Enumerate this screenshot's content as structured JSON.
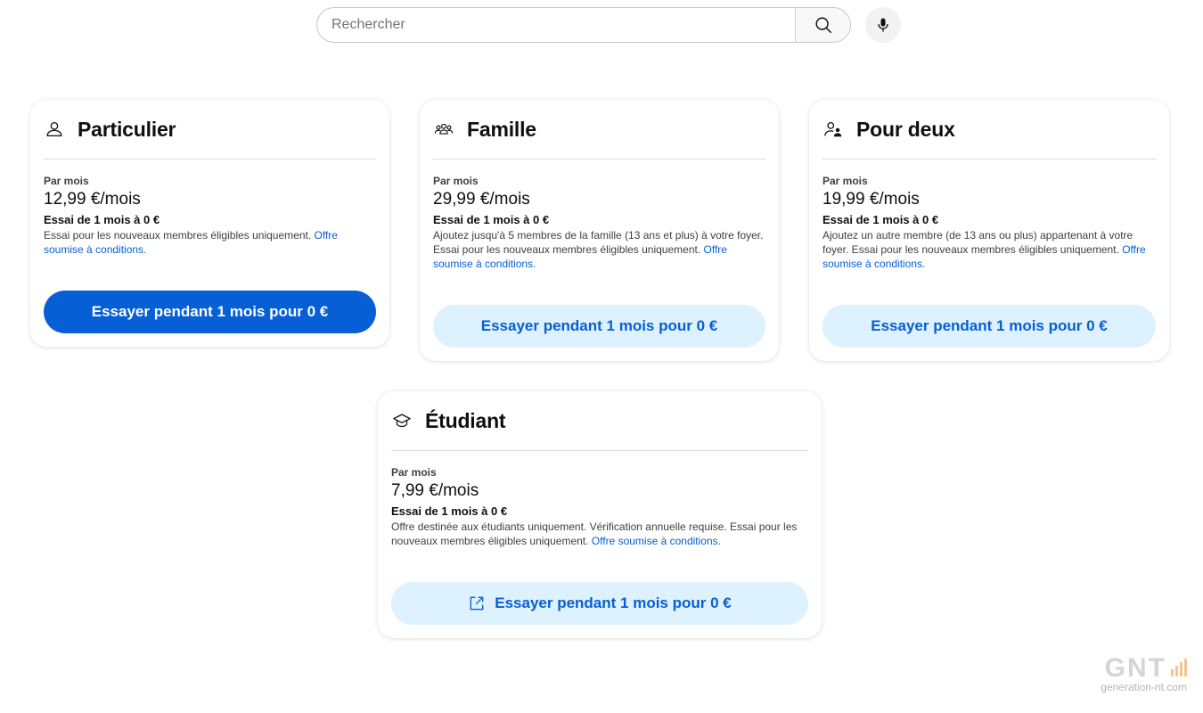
{
  "search": {
    "placeholder": "Rechercher",
    "value": ""
  },
  "plans": [
    {
      "title": "Particulier",
      "icon": "person-icon",
      "period": "Par mois",
      "price": "12,99 €/mois",
      "trial": "Essai de 1 mois à 0 €",
      "description": "Essai pour les nouveaux membres éligibles uniquement. ",
      "link": "Offre soumise à conditions.",
      "cta": "Essayer pendant 1 mois pour 0 €"
    },
    {
      "title": "Famille",
      "icon": "group-icon",
      "period": "Par mois",
      "price": "29,99 €/mois",
      "trial": "Essai de 1 mois à 0 €",
      "description": "Ajoutez jusqu'à 5 membres de la famille (13 ans et plus) à votre foyer. Essai pour les nouveaux membres éligibles uniquement. ",
      "link": "Offre soumise à conditions.",
      "cta": "Essayer pendant 1 mois pour 0 €"
    },
    {
      "title": "Pour deux",
      "icon": "two-people-icon",
      "period": "Par mois",
      "price": "19,99 €/mois",
      "trial": "Essai de 1 mois à 0 €",
      "description": "Ajoutez un autre membre (de 13 ans ou plus) appartenant à votre foyer. Essai pour les nouveaux membres éligibles uniquement. ",
      "link": "Offre soumise à conditions.",
      "cta": "Essayer pendant 1 mois pour 0 €"
    },
    {
      "title": "Étudiant",
      "icon": "graduation-cap-icon",
      "period": "Par mois",
      "price": "7,99 €/mois",
      "trial": "Essai de 1 mois à 0 €",
      "description": "Offre destinée aux étudiants uniquement. Vérification annuelle requise. Essai pour les nouveaux membres éligibles uniquement. ",
      "link": "Offre soumise à conditions.",
      "cta": "Essayer pendant 1 mois pour 0 €"
    }
  ],
  "watermark": {
    "logo": "GNT",
    "site": "generation-nt.com"
  },
  "colors": {
    "primary": "#065fd4",
    "light_button": "#def1ff"
  }
}
